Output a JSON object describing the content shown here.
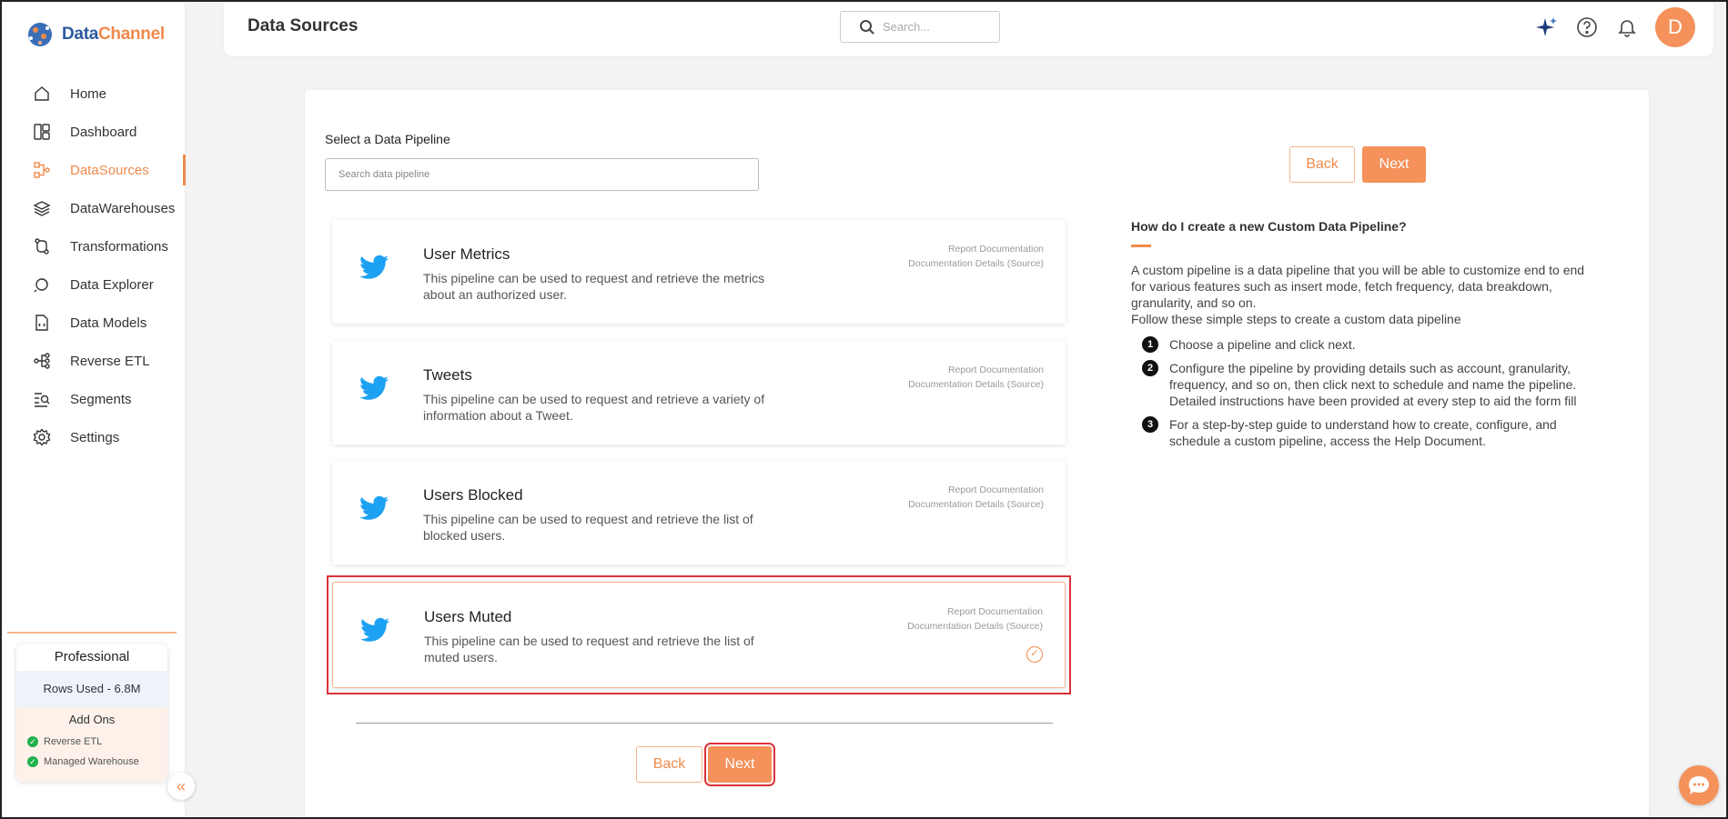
{
  "brand": {
    "name_part1": "Data",
    "name_part2": "Channel"
  },
  "nav": {
    "items": [
      {
        "label": "Home",
        "icon": "home-icon"
      },
      {
        "label": "Dashboard",
        "icon": "dashboard-icon"
      },
      {
        "label": "DataSources",
        "icon": "datasources-icon",
        "active": true
      },
      {
        "label": "DataWarehouses",
        "icon": "layers-icon"
      },
      {
        "label": "Transformations",
        "icon": "transform-icon"
      },
      {
        "label": "Data Explorer",
        "icon": "explorer-icon"
      },
      {
        "label": "Data Models",
        "icon": "models-icon"
      },
      {
        "label": "Reverse ETL",
        "icon": "reverse-etl-icon"
      },
      {
        "label": "Segments",
        "icon": "segments-icon"
      },
      {
        "label": "Settings",
        "icon": "gear-icon"
      }
    ]
  },
  "plan": {
    "name": "Professional",
    "rows_used": "Rows Used - 6.8M",
    "addons_title": "Add Ons",
    "addons": [
      "Reverse ETL",
      "Managed Warehouse"
    ]
  },
  "header": {
    "title": "Data Sources",
    "search_placeholder": "Search..."
  },
  "main": {
    "select_label": "Select a Data Pipeline",
    "search_placeholder": "Search data pipeline",
    "back_label": "Back",
    "next_label": "Next",
    "pipelines": [
      {
        "title": "User Metrics",
        "description": "This pipeline can be used to request and retrieve the metrics about an authorized user.",
        "link1": "Report Documentation",
        "link2": "Documentation Details (Source)"
      },
      {
        "title": "Tweets",
        "description": "This pipeline can be used to request and retrieve a variety of information about a Tweet.",
        "link1": "Report Documentation",
        "link2": "Documentation Details (Source)"
      },
      {
        "title": "Users Blocked",
        "description": "This pipeline can be used to request and retrieve the list of blocked users.",
        "link1": "Report Documentation",
        "link2": "Documentation Details (Source)"
      },
      {
        "title": "Users Muted",
        "description": "This pipeline can be used to request and retrieve the list of muted users.",
        "link1": "Report Documentation",
        "link2": "Documentation Details (Source)",
        "selected": true
      }
    ]
  },
  "help": {
    "title": "How do I create a new Custom Data Pipeline?",
    "intro": "A custom pipeline is a data pipeline that you will be able to customize end to end for various features such as insert mode, fetch frequency, data breakdown, granularity, and so on.",
    "follow": "Follow these simple steps to create a custom data pipeline",
    "steps": [
      {
        "num": "1",
        "text": "Choose a pipeline and click next."
      },
      {
        "num": "2",
        "text": "Configure the pipeline by providing details such as account, granularity, frequency, and so on, then click next to schedule and name the pipeline. Detailed instructions have been provided at every step to aid the form fill"
      },
      {
        "num": "3",
        "text": "For a step-by-step guide to understand how to create, configure, and schedule a custom pipeline, access the Help Document."
      }
    ]
  },
  "colors": {
    "accent": "#f5915a",
    "highlight": "#d9323a",
    "twitter": "#1da1f2"
  }
}
